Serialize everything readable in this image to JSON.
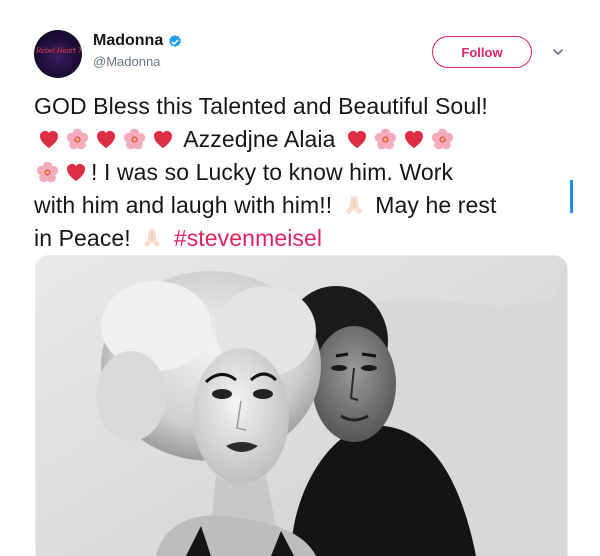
{
  "tweet": {
    "author": {
      "display_name": "Madonna",
      "handle": "@Madonna",
      "verified": true,
      "avatar_caption": "Rebel Heart Tour"
    },
    "follow_label": "Follow",
    "text_parts": {
      "line1": "GOD Bless this Talented and Beautiful Soul!",
      "name": "Azzedjne Alaia",
      "line2_rest": "! I was so Lucky to know him. Work",
      "line3_start": "with him and laugh with him!!",
      "line3_end": "May he rest",
      "line4_start": "in Peace!",
      "hashtag": "#stevenmeisel"
    },
    "photo": {
      "alt_icon": "black-and-white-portrait-photo"
    }
  },
  "colors": {
    "accent": "#e0245e",
    "verified_blue": "#1da1f2",
    "text": "#14171a",
    "secondary": "#657786"
  },
  "icons": [
    "verified-icon",
    "chevron-down-icon",
    "heart-emoji-icon",
    "flower-emoji-icon",
    "praying-hands-emoji-icon"
  ]
}
